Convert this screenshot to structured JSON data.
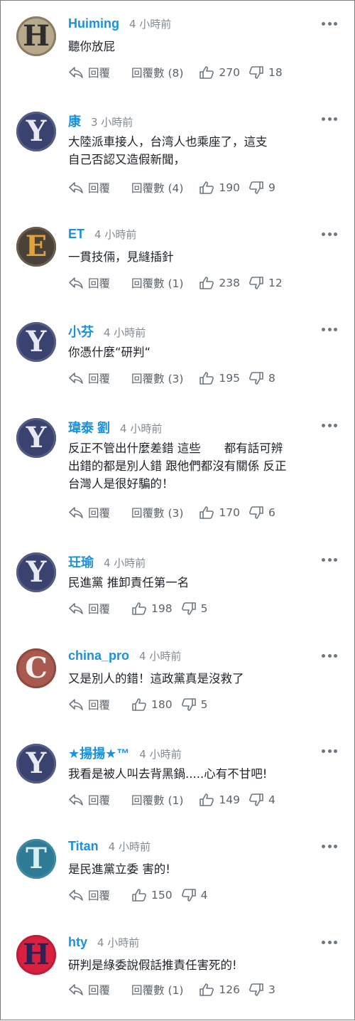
{
  "comments": [
    {
      "username": "Huiming",
      "time": "4 小時前",
      "text": "聽你放屁",
      "reply_label": "回覆",
      "replies_label": "回覆數 (8)",
      "likes": "270",
      "dislikes": "18",
      "avatar": {
        "letter": "H",
        "bg": "#b7a98c",
        "fg": "#2d2d2d",
        "ring": "#8a7d66"
      }
    },
    {
      "username": "康",
      "time": "3 小時前",
      "text": "大陸派車接人，台湾人也乘座了，這支\n自己否認又造假新聞，",
      "reply_label": "回覆",
      "replies_label": "回覆數 (4)",
      "likes": "190",
      "dislikes": "9",
      "avatar": {
        "letter": "Y",
        "bg": "#3a4270",
        "fg": "#e8e8f2",
        "ring": "#565d85"
      }
    },
    {
      "username": "ET",
      "time": "4 小時前",
      "text": "一貫技倆，見縫插針",
      "reply_label": "回覆",
      "replies_label": "回覆數 (1)",
      "likes": "238",
      "dislikes": "12",
      "avatar": {
        "letter": "E",
        "bg": "#4a4238",
        "fg": "#e0a23a",
        "ring": "#6a5d4c"
      }
    },
    {
      "username": "小芬",
      "time": "4 小時前",
      "text": "你憑什麼“研判“",
      "reply_label": "回覆",
      "replies_label": "回覆數 (3)",
      "likes": "195",
      "dislikes": "8",
      "avatar": {
        "letter": "Y",
        "bg": "#3a4270",
        "fg": "#e8e8f2",
        "ring": "#565d85"
      }
    },
    {
      "username": "瑋泰 劉",
      "time": "4 小時前",
      "text": "反正不管出什麼差錯 這些　　都有話可辨\n出錯的都是別人錯 跟他們都沒有關係 反正\n台灣人是很好騙的！",
      "reply_label": "回覆",
      "replies_label": "回覆數 (3)",
      "likes": "170",
      "dislikes": "6",
      "avatar": {
        "letter": "Y",
        "bg": "#3a4270",
        "fg": "#e8e8f2",
        "ring": "#565d85"
      }
    },
    {
      "username": "玨瑜",
      "time": "4 小時前",
      "text": "民進黨 推卸責任第一名",
      "reply_label": "回覆",
      "replies_label": "",
      "likes": "198",
      "dislikes": "5",
      "avatar": {
        "letter": "Y",
        "bg": "#3a4270",
        "fg": "#e8e8f2",
        "ring": "#565d85"
      }
    },
    {
      "username": "china_pro",
      "time": "4 小時前",
      "text": "又是別人的錯！這政黨真是沒救了",
      "reply_label": "回覆",
      "replies_label": "",
      "likes": "180",
      "dislikes": "5",
      "avatar": {
        "letter": "C",
        "bg": "#a85a4e",
        "fg": "#f4f1ee",
        "ring": "#8e4a40"
      }
    },
    {
      "username": "★揚揚★™",
      "time": "4 小時前",
      "text": "我看是被人叫去背黑鍋.....心有不甘吧!",
      "reply_label": "回覆",
      "replies_label": "回覆數 (1)",
      "likes": "149",
      "dislikes": "4",
      "avatar": {
        "letter": "Y",
        "bg": "#3a4270",
        "fg": "#e8e8f2",
        "ring": "#565d85"
      }
    },
    {
      "username": "Titan",
      "time": "4 小時前",
      "text": "是民進黨立委 害的!",
      "reply_label": "回覆",
      "replies_label": "",
      "likes": "150",
      "dislikes": "4",
      "avatar": {
        "letter": "T",
        "bg": "#2f7b95",
        "fg": "#d8eef5",
        "ring": "#3f8aa3"
      }
    },
    {
      "username": "hty",
      "time": "4 小時前",
      "text": "研判是綠委說假話推責任害死的!",
      "reply_label": "回覆",
      "replies_label": "回覆數 (1)",
      "likes": "126",
      "dislikes": "3",
      "avatar": {
        "letter": "H",
        "bg": "#d8213f",
        "fg": "#2b2257",
        "ring": "#c01c37"
      }
    }
  ]
}
